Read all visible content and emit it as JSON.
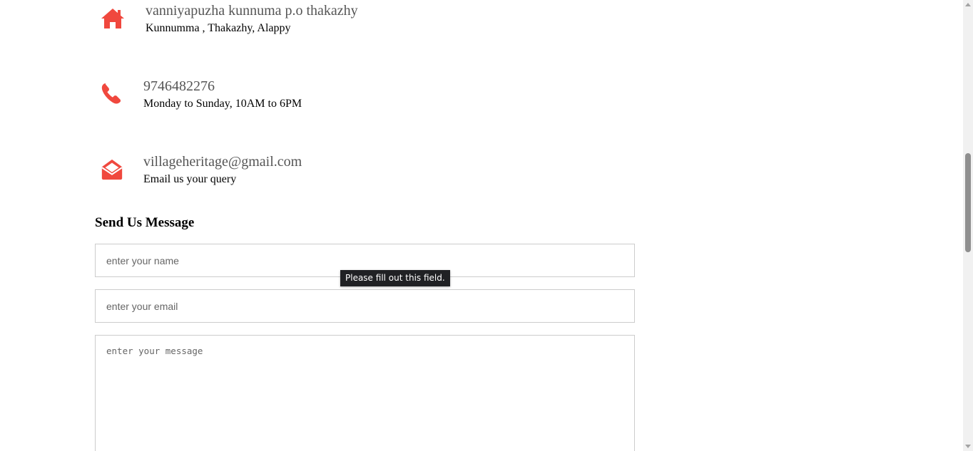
{
  "colors": {
    "icon_accent": "#f0483e",
    "main_text": "#555555",
    "tooltip_bg": "#202124"
  },
  "contact": {
    "address": {
      "icon": "home-icon",
      "title": "vanniyapuzha kunnuma p.o thakazhy",
      "subtitle": "Kunnumma , Thakazhy, Alappy"
    },
    "phone": {
      "icon": "phone-icon",
      "title": "9746482276",
      "subtitle": "Monday to Sunday, 10AM to 6PM"
    },
    "email": {
      "icon": "envelope-open-icon",
      "title": "villageheritage@gmail.com",
      "subtitle": "Email us your query"
    }
  },
  "form": {
    "title": "Send Us Message",
    "name_placeholder": "enter your name",
    "name_value": "",
    "email_placeholder": "enter your email",
    "email_value": "",
    "message_placeholder": "enter your message",
    "message_value": "",
    "validation_tooltip": "Please fill out this field."
  }
}
